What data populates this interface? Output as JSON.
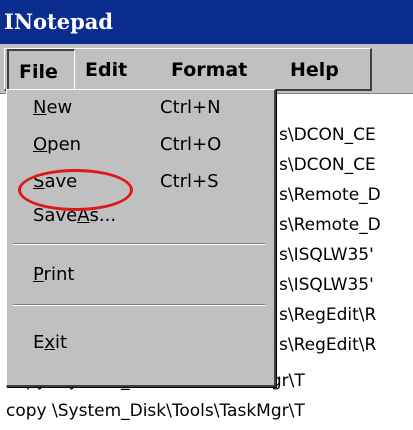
{
  "window": {
    "title": "INotepad"
  },
  "menubar": {
    "items": [
      {
        "label": "File"
      },
      {
        "label": "Edit"
      },
      {
        "label": "Format"
      },
      {
        "label": "Help"
      }
    ]
  },
  "file_menu": {
    "items": [
      {
        "pre": "",
        "mn": "N",
        "post": "ew",
        "shortcut": "Ctrl+N"
      },
      {
        "pre": "",
        "mn": "O",
        "post": "pen",
        "shortcut": "Ctrl+O"
      },
      {
        "pre": "",
        "mn": "S",
        "post": "ave",
        "shortcut": "Ctrl+S"
      },
      {
        "pre": "Save",
        "mn": "A",
        "post": "s...",
        "shortcut": ""
      },
      {
        "pre": "",
        "mn": "P",
        "post": "rint",
        "shortcut": ""
      },
      {
        "pre": "E",
        "mn": "x",
        "post": "it",
        "shortcut": ""
      }
    ]
  },
  "document": {
    "lines": [
      "s\\DCON_CE",
      "s\\DCON_CE",
      "s\\Remote_D",
      "s\\Remote_D",
      "s\\ISQLW35'",
      "s\\ISQLW35'",
      "s\\RegEdit\\R",
      "s\\RegEdit\\R",
      "copy \\System_Disk\\Tools\\TaskMgr\\T",
      "copy \\System_Disk\\Tools\\TaskMgr\\T"
    ]
  },
  "annotation": {
    "color": "#e01818",
    "target": "Save"
  }
}
